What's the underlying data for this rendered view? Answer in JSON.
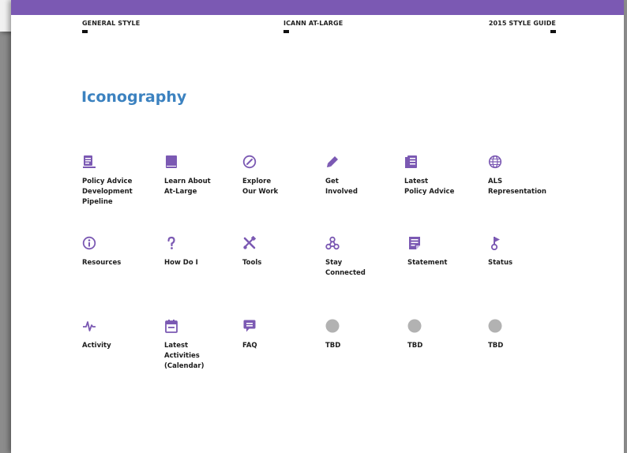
{
  "header": {
    "left": "GENERAL STYLE",
    "center": "ICANN AT-LARGE",
    "right": "2015 STYLE GUIDE"
  },
  "title": "Iconography",
  "colors": {
    "accent": "#7b59b3",
    "title": "#3c82c0",
    "placeholder": "#b2b2b2"
  },
  "icons": [
    {
      "icon": "policy-pipeline-icon",
      "label": "Policy Advice\nDevelopment\nPipeline"
    },
    {
      "icon": "book-icon",
      "label": "Learn About\nAt-Large"
    },
    {
      "icon": "compass-icon",
      "label": "Explore\nOur Work"
    },
    {
      "icon": "pencil-icon",
      "label": "Get\nInvolved"
    },
    {
      "icon": "document-icon",
      "label": "Latest\nPolicy Advice"
    },
    {
      "icon": "globe-icon",
      "label": "ALS\nRepresentation"
    },
    {
      "icon": "info-icon",
      "label": "Resources"
    },
    {
      "icon": "question-icon",
      "label": "How Do I"
    },
    {
      "icon": "tools-icon",
      "label": "Tools"
    },
    {
      "icon": "share-icon",
      "label": "Stay\nConnected"
    },
    {
      "icon": "statement-icon",
      "label": "Statement"
    },
    {
      "icon": "status-icon",
      "label": "Status"
    },
    {
      "icon": "activity-icon",
      "label": "Activity"
    },
    {
      "icon": "calendar-icon",
      "label": "Latest\nActivities\n(Calendar)"
    },
    {
      "icon": "faq-icon",
      "label": "FAQ"
    },
    {
      "icon": "placeholder-icon",
      "label": "TBD"
    },
    {
      "icon": "placeholder-icon",
      "label": "TBD"
    },
    {
      "icon": "placeholder-icon",
      "label": "TBD"
    }
  ]
}
